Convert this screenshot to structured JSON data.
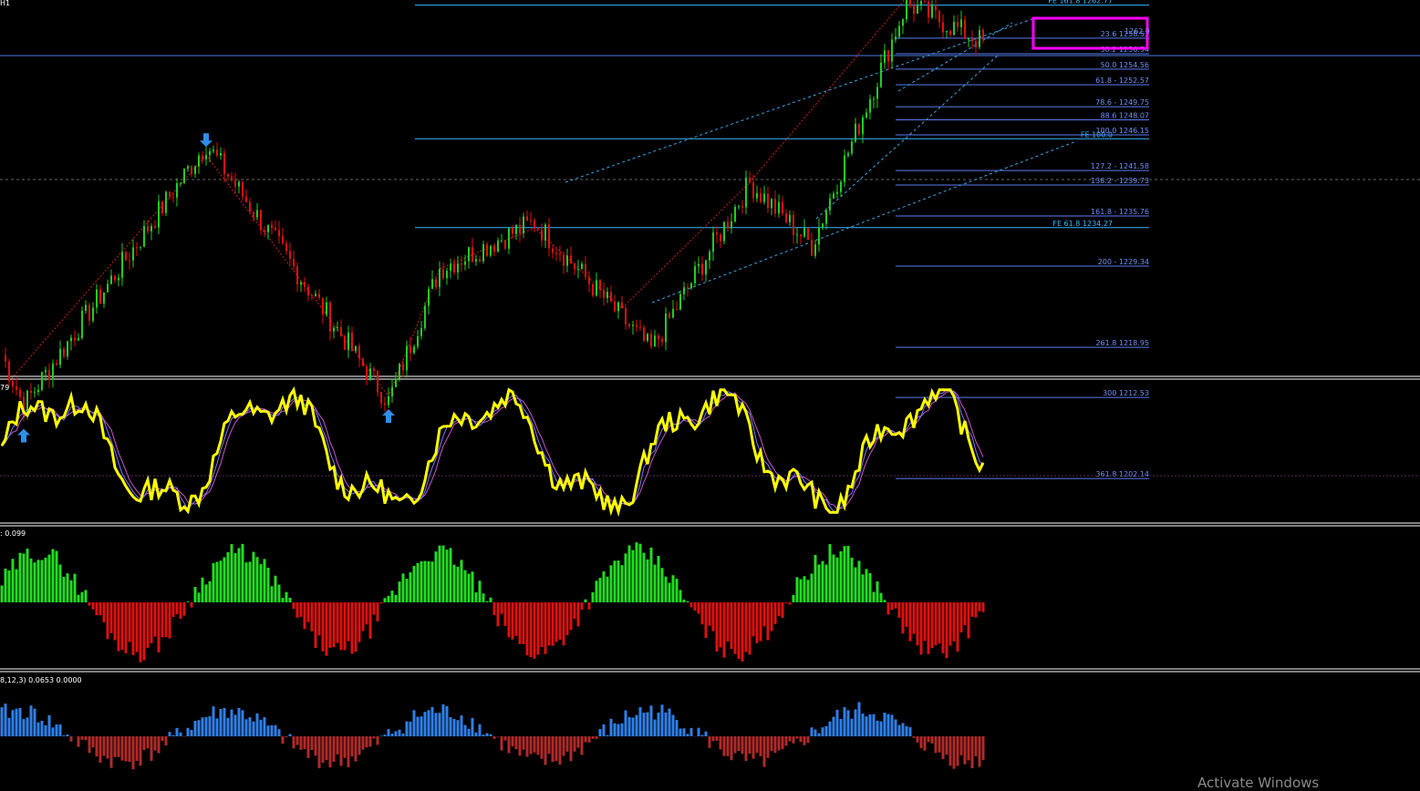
{
  "window": {
    "timeframe": "H1"
  },
  "panes": {
    "stoch_label": "79",
    "osc_label": ": 0.099",
    "macd_label": "8,12,3) 0.0653 0.0000"
  },
  "colors": {
    "bull": "#22cc22",
    "bear": "#dd1111",
    "fib": "#5a7cf0",
    "fe": "#38b8ff",
    "channel": "#3aa6e8",
    "zigzag": "#cc2222",
    "signal": "#2f8fe8",
    "stoch_main": "#ffff00",
    "stoch_sig1": "#7777ff",
    "stoch_sig2": "#cc55cc",
    "hist_up": "#22dd22",
    "hist_down": "#dd1111",
    "macd_up": "#2f7fe8",
    "macd_down": "#b02a2a",
    "highlight": "#ff00ff"
  },
  "chart_data": [
    {
      "type": "candlestick",
      "timeframe": "H1",
      "price_axis": "right (not shown)",
      "fib_levels": [
        {
          "label": "23.6 1258.53",
          "price": 1258.53
        },
        {
          "label": "38.2 1256.54",
          "price": 1256.54
        },
        {
          "label": "50.0 1254.56",
          "price": 1254.56
        },
        {
          "label": "61.8 - 1252.57",
          "price": 1252.57
        },
        {
          "label": "78.6 - 1249.75",
          "price": 1249.75
        },
        {
          "label": "88.6 1248.07",
          "price": 1248.07
        },
        {
          "label": "100.0 1246.15",
          "price": 1246.15
        },
        {
          "label": "127.2 - 1241.58",
          "price": 1241.58
        },
        {
          "label": "138.2 - 1239.73",
          "price": 1239.73
        },
        {
          "label": "161.8 - 1235.76",
          "price": 1235.76
        },
        {
          "label": "200 - 1229.34",
          "price": 1229.34
        },
        {
          "label": "261.8 1218.95",
          "price": 1218.95
        },
        {
          "label": "300 1212.53",
          "price": 1212.53
        },
        {
          "label": "361.8 1202.14",
          "price": 1202.14
        }
      ],
      "fe_levels": [
        {
          "label": "FE 161.8 1262.77",
          "price": 1262.77
        },
        {
          "label": "FE 100.0",
          "price": 1245.65
        },
        {
          "label": "FE 61.8 1234.27",
          "price": 1234.27
        }
      ],
      "top_partial_label": "1262.9",
      "arrows": [
        {
          "type": "up",
          "bar": 6
        },
        {
          "type": "down",
          "bar": 56
        },
        {
          "type": "up",
          "bar": 106
        },
        {
          "type": "down",
          "bar": 248
        }
      ],
      "zigzag_bars": [
        2,
        56,
        106,
        120,
        146,
        170,
        205,
        248
      ],
      "price_range": [
        1202,
        1267
      ]
    },
    {
      "type": "line",
      "name": "stochastic",
      "label": "79",
      "ylim": [
        0,
        100
      ]
    },
    {
      "type": "bar",
      "name": "oscillator histogram",
      "label": ": 0.099"
    },
    {
      "type": "bar",
      "name": "macd histogram",
      "label": "8,12,3) 0.0653 0.0000"
    }
  ],
  "watermark": "Activate Windows"
}
